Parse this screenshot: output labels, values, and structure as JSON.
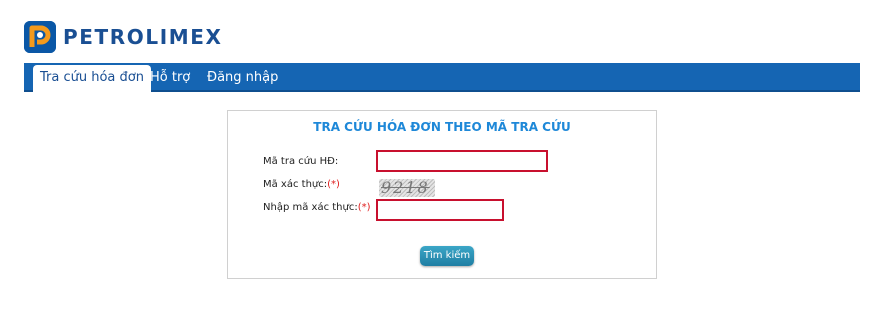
{
  "brand": {
    "name": "PETROLIMEX",
    "logo_icon": "petrolimex-logo-icon"
  },
  "nav": {
    "items": [
      {
        "label": "Tra cứu hóa đơn",
        "active": true
      },
      {
        "label": "Hỗ trợ",
        "active": false
      },
      {
        "label": "Đăng nhập",
        "active": false
      }
    ]
  },
  "form": {
    "title": "TRA CỨU HÓA ĐƠN THEO MÃ TRA CỨU",
    "lookup_label": "Mã tra cứu HĐ:",
    "lookup_value": "",
    "captcha_label": "Mã xác thực:",
    "captcha_text": "9218",
    "captcha_input_label": "Nhập mã xác thực:",
    "captcha_input_value": "",
    "required_mark": "(*)",
    "submit_label": "Tìm kiếm"
  },
  "colors": {
    "nav_bg": "#1565b3",
    "title_blue": "#1e88d8",
    "input_border": "#c8102e",
    "button": "#2a93b8"
  }
}
